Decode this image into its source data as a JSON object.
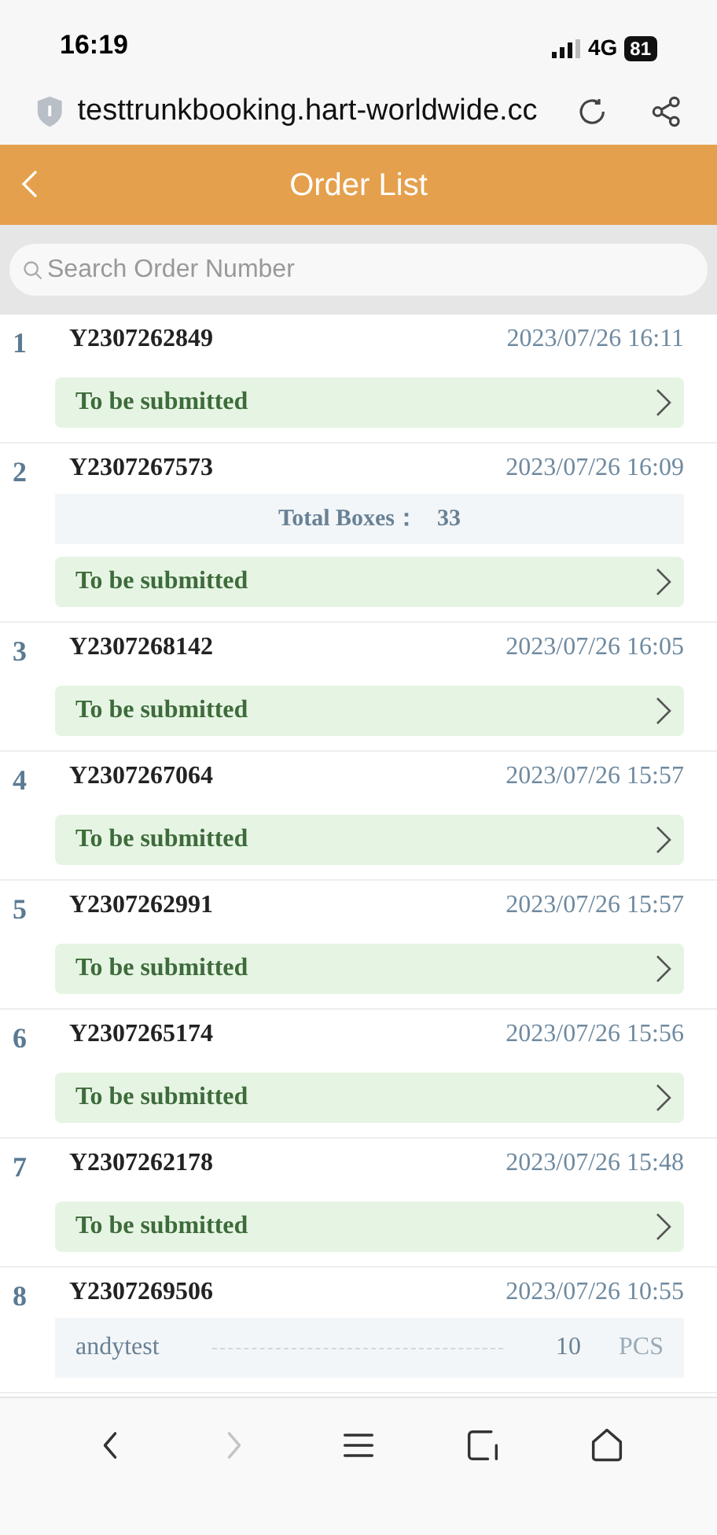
{
  "status_bar": {
    "time": "16:19",
    "network": "4G",
    "battery": "81"
  },
  "address_bar": {
    "url": "testtrunkbooking.hart-worldwide.cc"
  },
  "header": {
    "title": "Order List"
  },
  "search": {
    "placeholder": "Search Order Number"
  },
  "orders": [
    {
      "index": "1",
      "order_no": "Y2307262849",
      "time": "2023/07/26 16:11",
      "status": "To be submitted"
    },
    {
      "index": "2",
      "order_no": "Y2307267573",
      "time": "2023/07/26 16:09",
      "total_boxes": {
        "label": "Total Boxes：",
        "value": "33"
      },
      "status": "To be submitted"
    },
    {
      "index": "3",
      "order_no": "Y2307268142",
      "time": "2023/07/26 16:05",
      "status": "To be submitted"
    },
    {
      "index": "4",
      "order_no": "Y2307267064",
      "time": "2023/07/26 15:57",
      "status": "To be submitted"
    },
    {
      "index": "5",
      "order_no": "Y2307262991",
      "time": "2023/07/26 15:57",
      "status": "To be submitted"
    },
    {
      "index": "6",
      "order_no": "Y2307265174",
      "time": "2023/07/26 15:56",
      "status": "To be submitted"
    },
    {
      "index": "7",
      "order_no": "Y2307262178",
      "time": "2023/07/26 15:48",
      "status": "To be submitted"
    },
    {
      "index": "8",
      "order_no": "Y2307269506",
      "time": "2023/07/26 10:55",
      "lines": [
        {
          "name": "andytest",
          "qty": "10",
          "unit": "PCS"
        }
      ]
    }
  ],
  "browser_nav": [
    {
      "kind": "back",
      "disabled": false
    },
    {
      "kind": "forward",
      "disabled": true
    },
    {
      "kind": "menu",
      "disabled": false
    },
    {
      "kind": "tabs",
      "disabled": false
    },
    {
      "kind": "home",
      "disabled": false
    }
  ]
}
